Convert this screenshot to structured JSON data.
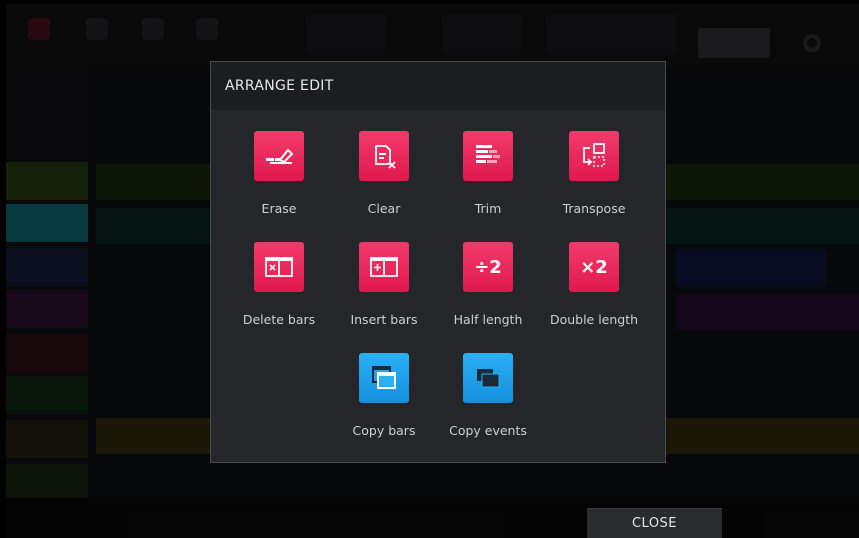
{
  "dialog": {
    "title": "ARRANGE EDIT",
    "tools": [
      {
        "label": "Erase",
        "icon": "erase-icon",
        "color": "#e8285a"
      },
      {
        "label": "Clear",
        "icon": "clear-icon",
        "color": "#e8285a"
      },
      {
        "label": "Trim",
        "icon": "trim-icon",
        "color": "#e8285a"
      },
      {
        "label": "Transpose",
        "icon": "transpose-icon",
        "color": "#e8285a"
      },
      {
        "label": "Delete bars",
        "icon": "delete-bars-icon",
        "color": "#e8285a"
      },
      {
        "label": "Insert bars",
        "icon": "insert-bars-icon",
        "color": "#e8285a"
      },
      {
        "label": "Half length",
        "icon": "half-length-icon",
        "glyph": "÷2",
        "color": "#e8285a"
      },
      {
        "label": "Double length",
        "icon": "double-length-icon",
        "glyph": "×2",
        "color": "#e8285a"
      },
      {
        "label": "Copy bars",
        "icon": "copy-bars-icon",
        "color": "#1ea2ea"
      },
      {
        "label": "Copy events",
        "icon": "copy-events-icon",
        "color": "#1ea2ea"
      }
    ]
  },
  "footer": {
    "close_label": "CLOSE"
  },
  "colors": {
    "accent_pink": "#e8285a",
    "accent_blue": "#1ea2ea",
    "panel": "#25262a",
    "header": "#1c1d20"
  }
}
